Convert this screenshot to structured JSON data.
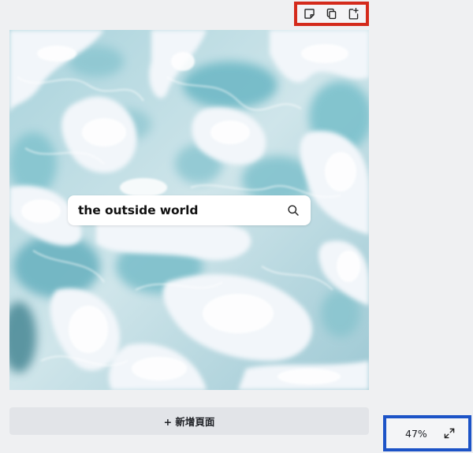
{
  "page_toolbar": {
    "buttons": [
      {
        "icon": "sticky-note-icon"
      },
      {
        "icon": "duplicate-icon"
      },
      {
        "icon": "add-page-icon"
      }
    ],
    "highlight_color": "#d42a1b"
  },
  "canvas": {
    "background_image": "sea-foam-image",
    "search_box": {
      "text": "the outside world",
      "icon": "search-icon"
    }
  },
  "add_page_button": {
    "label": "+ 新增頁面"
  },
  "zoom_control": {
    "value": "47%",
    "icon": "fullscreen-icon",
    "highlight_color": "#1c53c7"
  }
}
